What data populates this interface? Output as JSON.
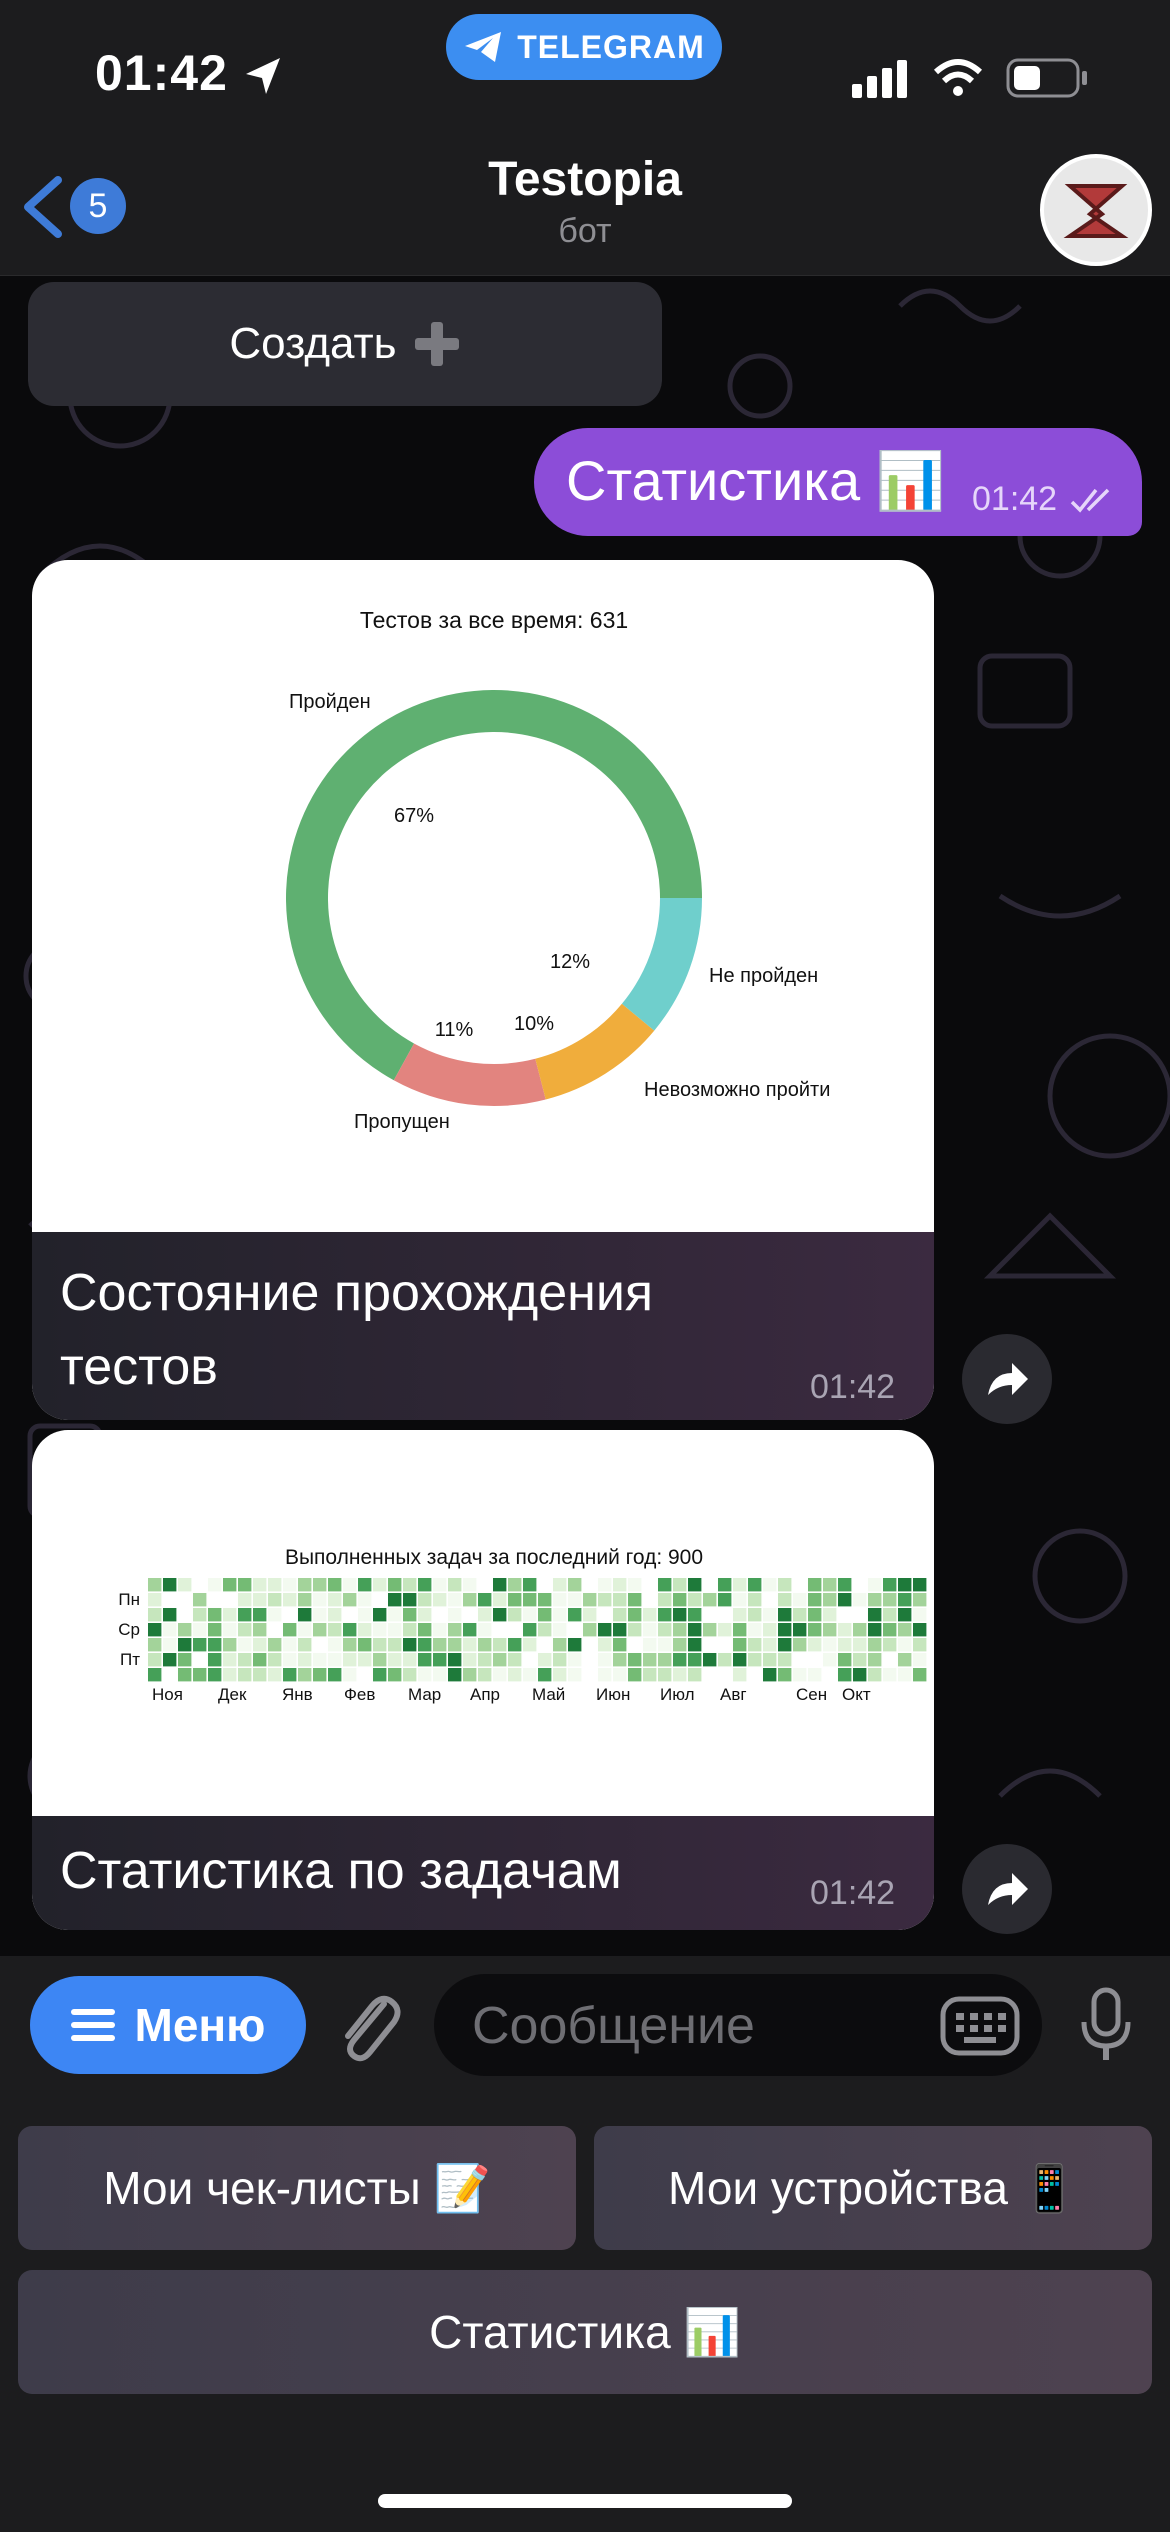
{
  "status_bar": {
    "time": "01:42",
    "app_pill": "TELEGRAM"
  },
  "header": {
    "back_count": "5",
    "title": "Testopia",
    "subtitle": "бот"
  },
  "chat": {
    "create_button": "Создать",
    "outgoing": {
      "text": "Статистика 📊",
      "time": "01:42"
    },
    "messages": [
      {
        "caption": "Состояние прохождения тестов",
        "time": "01:42"
      },
      {
        "caption": "Статистика по задачам",
        "time": "01:42"
      }
    ]
  },
  "input": {
    "menu_label": "Меню",
    "placeholder": "Сообщение"
  },
  "keyboard": {
    "btn1": "Мои чек-листы 📝",
    "btn2": "Мои устройства 📱",
    "btn3": "Статистика 📊"
  },
  "chart_data": [
    {
      "type": "pie",
      "title": "Тестов за все время: 631",
      "donut": true,
      "categories": [
        "Пройден",
        "Не пройден",
        "Невозможно пройти",
        "Пропущен"
      ],
      "values": [
        67,
        12,
        10,
        11
      ],
      "value_labels": [
        "67%",
        "12%",
        "10%",
        "11%"
      ],
      "colors": [
        "#5fb071",
        "#e2847f",
        "#f0ad3c",
        "#6fcfcc"
      ]
    },
    {
      "type": "heatmap",
      "title": "Выполненных задач за последний год: 900",
      "y_labels": [
        "Пн",
        "Ср",
        "Пт"
      ],
      "x_labels": [
        "Ноя",
        "Дек",
        "Янв",
        "Фев",
        "Мар",
        "Апр",
        "Май",
        "Июн",
        "Июл",
        "Авг",
        "Сен",
        "Окт"
      ],
      "total": 900
    }
  ]
}
